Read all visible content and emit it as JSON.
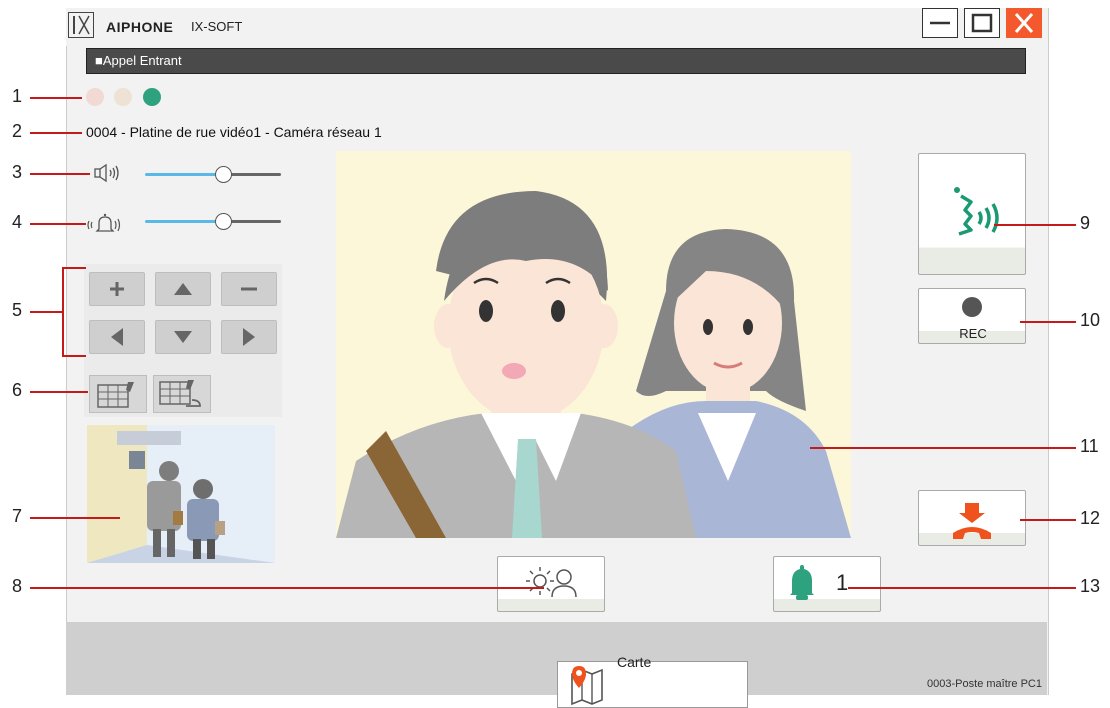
{
  "window": {
    "brand": "AIPHONE",
    "product": "IX-SOFT",
    "logo_text": "IX",
    "controls": [
      "minimize-icon",
      "maximize-icon",
      "close-icon"
    ]
  },
  "header": {
    "title": "■Appel Entrant"
  },
  "status": {
    "dots": [
      {
        "name": "status-light-1",
        "color": "#f2d9d3"
      },
      {
        "name": "status-light-2",
        "color": "#ede2d3"
      },
      {
        "name": "status-light-3",
        "color": "#2ea27f"
      }
    ]
  },
  "caller": {
    "station_name": "0004 - Platine de rue vidéo1 - Caméra réseau 1"
  },
  "volume": {
    "speaker_level": 0.58,
    "ring_level": 0.58,
    "speaker_icon": "speaker-volume-icon",
    "ring_icon": "ringtone-volume-icon"
  },
  "camera_controls": {
    "buttons": [
      "zoom-in",
      "pan-up",
      "zoom-out",
      "pan-left",
      "pan-down",
      "pan-right"
    ]
  },
  "screen_split": {
    "buttons": [
      "split-screen-icon",
      "split-return-icon"
    ]
  },
  "right_panel": {
    "talk_icon": "talk-icon",
    "rec_label": "REC",
    "hangup_icon": "hangup-icon"
  },
  "bottom": {
    "brightness_icon": "brightness-person-icon",
    "bell_icon": "bell-icon",
    "bell_count": "1",
    "map_label": "Carte",
    "map_icon": "map-icon",
    "status_text": "0003-Poste maître PC1"
  },
  "callouts": [
    "1",
    "2",
    "3",
    "4",
    "5",
    "6",
    "7",
    "8",
    "9",
    "10",
    "11",
    "12",
    "13"
  ],
  "colors": {
    "accent_green": "#2ea27f",
    "close_red": "#f3592d",
    "slider_blue": "#5ab8e6",
    "hangup_orange": "#f0521d",
    "callout_red": "#c31a1a"
  }
}
